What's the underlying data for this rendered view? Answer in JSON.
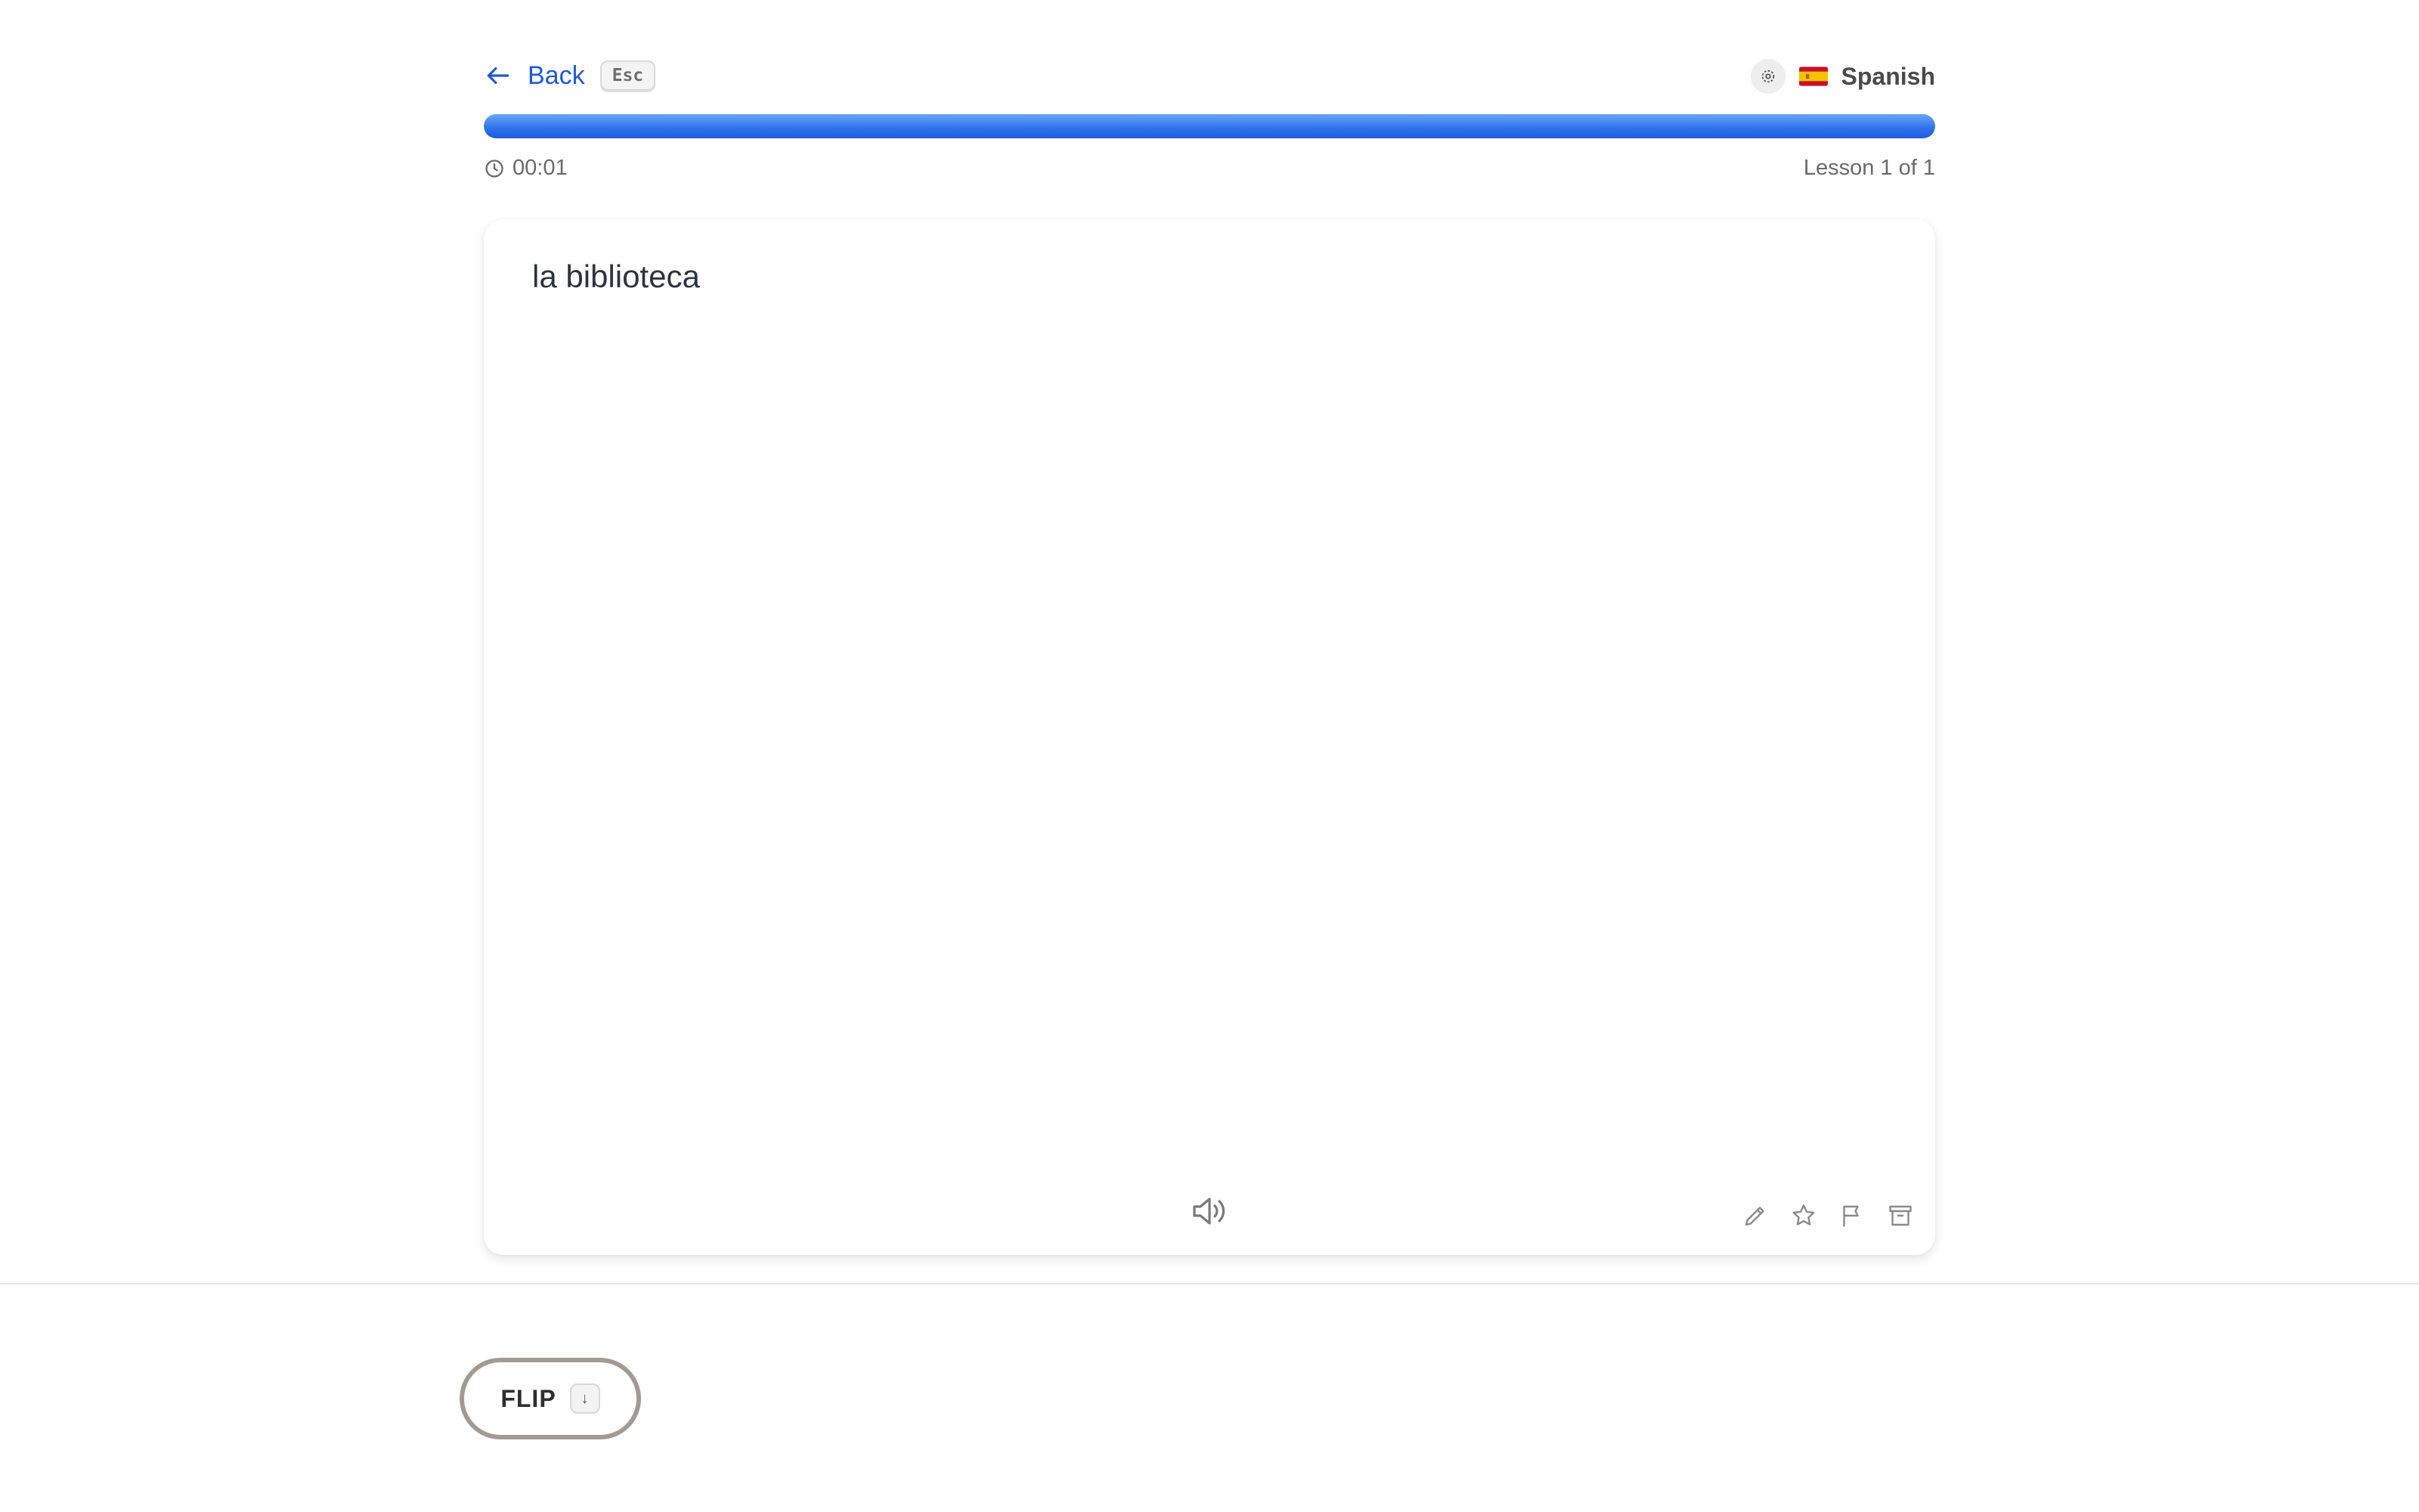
{
  "header": {
    "back_label": "Back",
    "back_shortcut": "Esc",
    "language": "Spanish",
    "flag_icon": "spain-flag-icon",
    "settings_icon": "settings-icon"
  },
  "progress": {
    "fraction": 1.0,
    "color": "#2f74ec",
    "timer": "00:01",
    "lesson_label": "Lesson 1 of 1"
  },
  "card": {
    "term": "la biblioteca",
    "audio_icon": "speaker-icon",
    "tools": [
      "pencil-icon",
      "star-icon",
      "flag-icon",
      "archive-icon"
    ]
  },
  "actions": {
    "flip_label": "FLIP",
    "flip_shortcut": "↓"
  }
}
